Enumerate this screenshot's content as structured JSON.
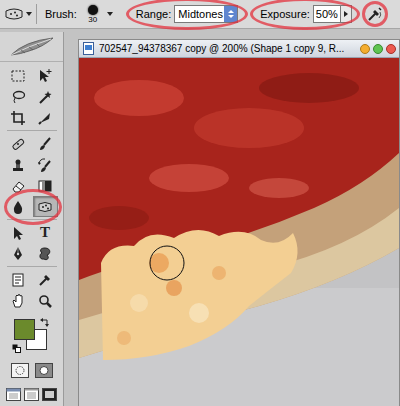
{
  "options_bar": {
    "brush": {
      "label": "Brush:",
      "size": "30"
    },
    "range": {
      "label": "Range:",
      "value": "Midtones",
      "highlighted": true
    },
    "exposure": {
      "label": "Exposure:",
      "value": "50%",
      "highlighted": true
    },
    "airbrush": {
      "highlighted": true
    }
  },
  "toolbox": {
    "tools": [
      {
        "selected": false,
        "highlighted": false
      },
      {
        "selected": false,
        "highlighted": false
      },
      {
        "selected": false,
        "highlighted": false
      },
      {
        "selected": false,
        "highlighted": false
      },
      {
        "selected": false,
        "highlighted": false
      },
      {
        "selected": false,
        "highlighted": false
      },
      {
        "selected": false,
        "highlighted": false
      },
      {
        "selected": false,
        "highlighted": false
      },
      {
        "selected": false,
        "highlighted": false
      },
      {
        "selected": false,
        "highlighted": false
      },
      {
        "selected": false,
        "highlighted": false
      },
      {
        "selected": false,
        "highlighted": false
      },
      {
        "selected": false,
        "highlighted": false
      },
      {
        "selected": true,
        "highlighted": true
      },
      {
        "selected": false,
        "highlighted": false
      },
      {
        "selected": false,
        "highlighted": false,
        "glyph": "T"
      },
      {
        "selected": false,
        "highlighted": false
      },
      {
        "selected": false,
        "highlighted": false
      },
      {
        "selected": false,
        "highlighted": false
      },
      {
        "selected": false,
        "highlighted": false
      },
      {
        "selected": false,
        "highlighted": false
      },
      {
        "selected": false,
        "highlighted": false
      }
    ],
    "swatches": [
      {
        "name": "foreground",
        "color": "#6b8a2c"
      },
      {
        "name": "background",
        "color": "#ffffff"
      }
    ]
  },
  "document": {
    "title": "702547_94378367 copy @ 200% (Shape 1 copy 9, R..."
  }
}
